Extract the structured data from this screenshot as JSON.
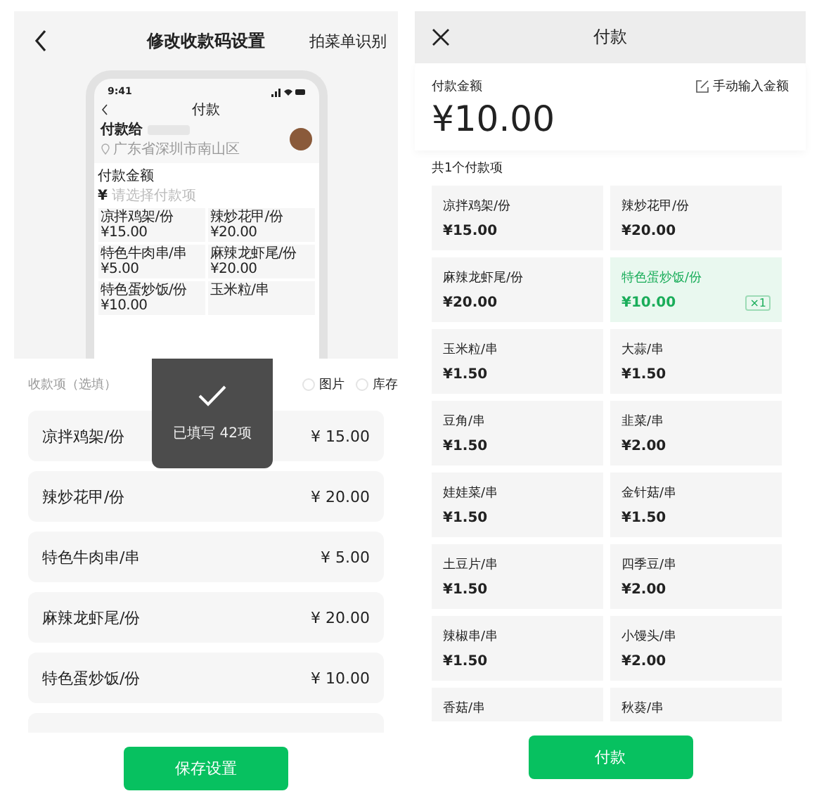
{
  "left_screen": {
    "header": {
      "title": "修改收款码设置",
      "action": "拍菜单识别"
    },
    "preview": {
      "time": "9:41",
      "title": "付款",
      "payee_label": "付款给",
      "address": "广东省深圳市南山区",
      "amount_label": "付款金额",
      "currency": "¥",
      "placeholder": "请选择付款项",
      "items": [
        {
          "name": "凉拌鸡架/份",
          "price": "¥15.00"
        },
        {
          "name": "辣炒花甲/份",
          "price": "¥20.00"
        },
        {
          "name": "特色牛肉串/串",
          "price": "¥5.00"
        },
        {
          "name": "麻辣龙虾尾/份",
          "price": "¥20.00"
        },
        {
          "name": "特色蛋炒饭/份",
          "price": "¥10.00"
        },
        {
          "name": "玉米粒/串"
        }
      ]
    },
    "toast": "已填写 42项",
    "section_label": "收款项（选填）",
    "options": [
      {
        "label": "图片",
        "checked": false
      },
      {
        "label": "库存",
        "checked": false
      }
    ],
    "rows": [
      {
        "name": "凉拌鸡架/份",
        "price": "¥ 15.00"
      },
      {
        "name": "辣炒花甲/份",
        "price": "¥ 20.00"
      },
      {
        "name": "特色牛肉串/串",
        "price": "¥ 5.00"
      },
      {
        "name": "麻辣龙虾尾/份",
        "price": "¥ 20.00"
      },
      {
        "name": "特色蛋炒饭/份",
        "price": "¥ 10.00"
      }
    ],
    "save_button": "保存设置"
  },
  "right_screen": {
    "header": {
      "title": "付款"
    },
    "amount_label": "付款金额",
    "manual_entry": "手动输入金额",
    "amount": "¥10.00",
    "item_count": "共1个付款项",
    "items": [
      {
        "name": "凉拌鸡架/份",
        "price": "¥15.00",
        "selected": false
      },
      {
        "name": "辣炒花甲/份",
        "price": "¥20.00",
        "selected": false
      },
      {
        "name": "麻辣龙虾尾/份",
        "price": "¥20.00",
        "selected": false
      },
      {
        "name": "特色蛋炒饭/份",
        "price": "¥10.00",
        "selected": true,
        "badge": "×1"
      },
      {
        "name": "玉米粒/串",
        "price": "¥1.50",
        "selected": false
      },
      {
        "name": "大蒜/串",
        "price": "¥1.50",
        "selected": false
      },
      {
        "name": "豆角/串",
        "price": "¥1.50",
        "selected": false
      },
      {
        "name": "韭菜/串",
        "price": "¥2.00",
        "selected": false
      },
      {
        "name": "娃娃菜/串",
        "price": "¥1.50",
        "selected": false
      },
      {
        "name": "金针菇/串",
        "price": "¥1.50",
        "selected": false
      },
      {
        "name": "土豆片/串",
        "price": "¥1.50",
        "selected": false
      },
      {
        "name": "四季豆/串",
        "price": "¥2.00",
        "selected": false
      },
      {
        "name": "辣椒串/串",
        "price": "¥1.50",
        "selected": false
      },
      {
        "name": "小馒头/串",
        "price": "¥2.00",
        "selected": false
      },
      {
        "name": "香菇/串",
        "selected": false
      },
      {
        "name": "秋葵/串",
        "selected": false
      }
    ],
    "pay_button": "付款"
  }
}
